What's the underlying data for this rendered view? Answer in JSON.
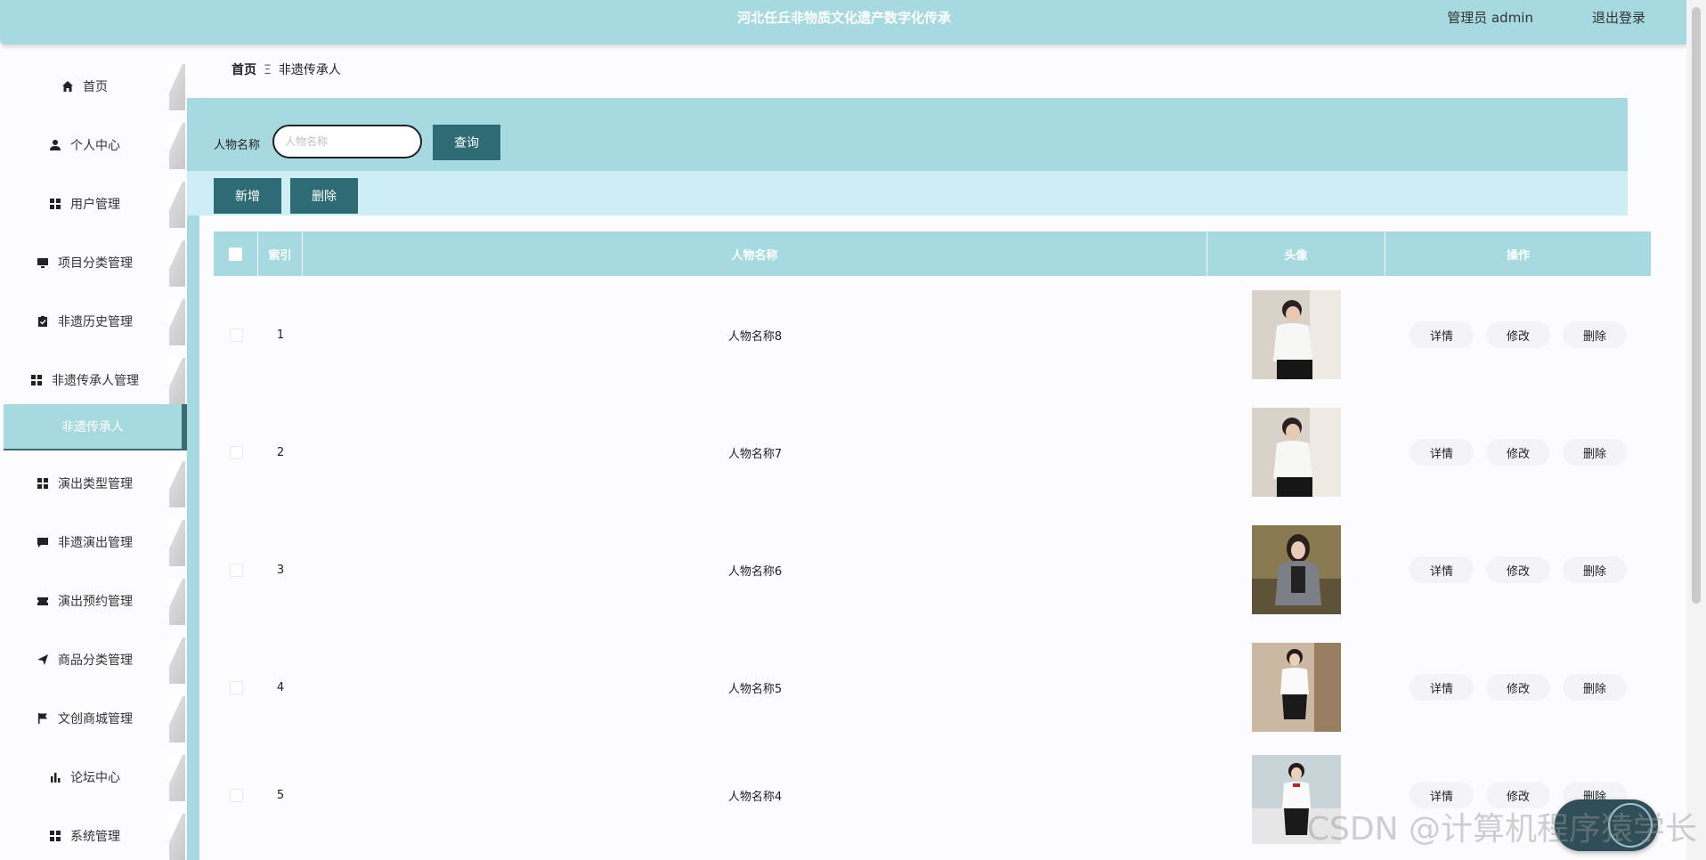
{
  "header": {
    "title": "河北任丘非物质文化遗产数字化传承",
    "user": "管理员 admin",
    "logout": "退出登录"
  },
  "sidebar": {
    "items": [
      {
        "label": "首页",
        "icon": "home-icon"
      },
      {
        "label": "个人中心",
        "icon": "user-icon"
      },
      {
        "label": "用户管理",
        "icon": "grid-icon"
      },
      {
        "label": "项目分类管理",
        "icon": "monitor-icon"
      },
      {
        "label": "非遗历史管理",
        "icon": "clipboard-icon"
      },
      {
        "label": "非遗传承人管理",
        "icon": "grid-icon"
      },
      {
        "label": "非遗传承人",
        "icon": "",
        "active": true
      },
      {
        "label": "演出类型管理",
        "icon": "grid-icon"
      },
      {
        "label": "非遗演出管理",
        "icon": "comment-icon"
      },
      {
        "label": "演出预约管理",
        "icon": "ticket-icon"
      },
      {
        "label": "商品分类管理",
        "icon": "send-icon"
      },
      {
        "label": "文创商城管理",
        "icon": "flag-icon"
      },
      {
        "label": "论坛中心",
        "icon": "bar-chart-icon"
      },
      {
        "label": "系统管理",
        "icon": "grid-icon"
      }
    ]
  },
  "breadcrumb": {
    "home": "首页",
    "separator": "Ξ",
    "current": "非遗传承人"
  },
  "search": {
    "label": "人物名称",
    "placeholder": "人物名称",
    "button": "查询"
  },
  "actions": {
    "add": "新增",
    "delete": "删除"
  },
  "table": {
    "columns": [
      "索引",
      "人物名称",
      "头像",
      "操作"
    ],
    "rows": [
      {
        "index": "1",
        "name": "人物名称8"
      },
      {
        "index": "2",
        "name": "人物名称7"
      },
      {
        "index": "3",
        "name": "人物名称6"
      },
      {
        "index": "4",
        "name": "人物名称5"
      },
      {
        "index": "5",
        "name": "人物名称4"
      }
    ],
    "ops": {
      "detail": "详情",
      "edit": "修改",
      "delete": "删除"
    }
  },
  "watermark": "CSDN @计算机程序猿学长",
  "colors": {
    "accent": "#a7d9e1",
    "dark_button": "#2e6b75",
    "light_band": "#cdeef4"
  }
}
